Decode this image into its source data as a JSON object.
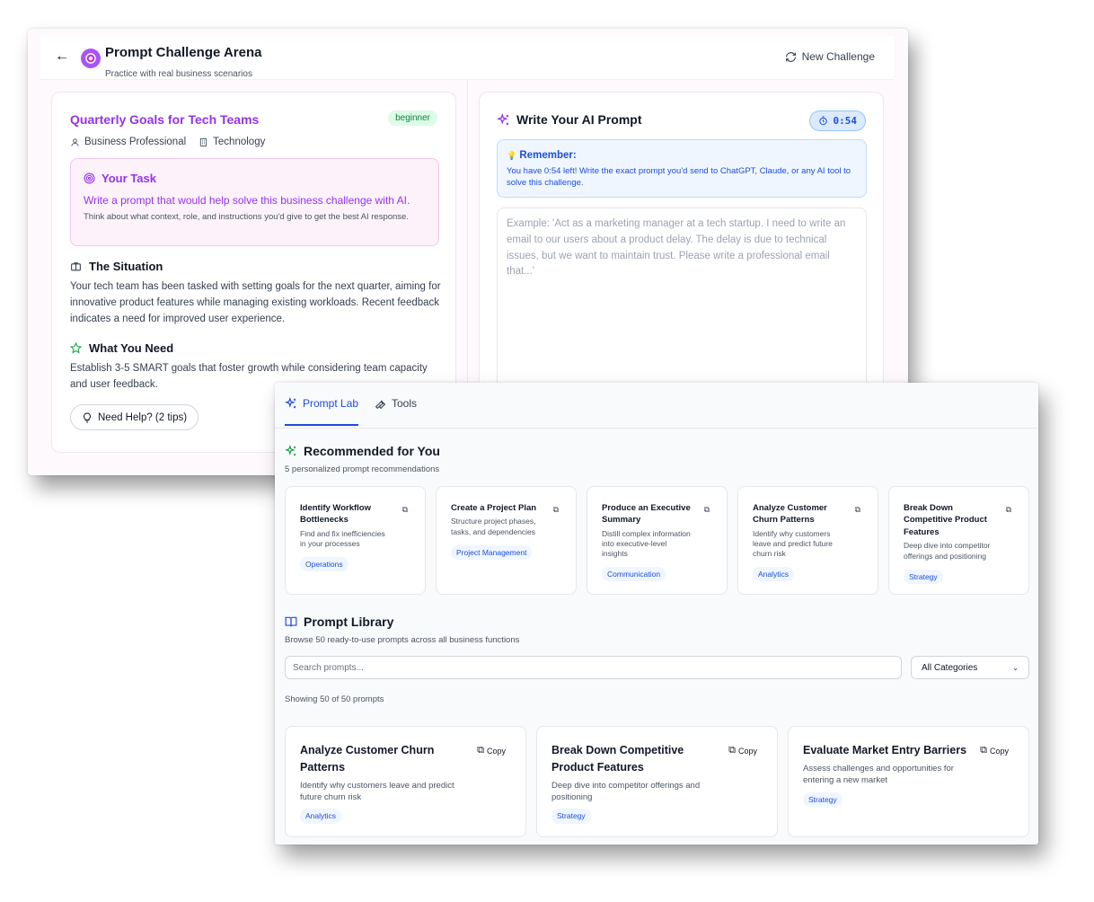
{
  "arena": {
    "title": "Prompt Challenge Arena",
    "subtitle": "Practice with real business scenarios",
    "new_challenge": "New Challenge",
    "challenge": {
      "title": "Quarterly Goals for Tech Teams",
      "level": "beginner",
      "role": "Business Professional",
      "industry": "Technology",
      "task_heading": "Your Task",
      "task_line": "Write a prompt that would help solve this business challenge with AI.",
      "task_hint": "Think about what context, role, and instructions you'd give to get the best AI response.",
      "situation_heading": "The Situation",
      "situation_text": "Your tech team has been tasked with setting goals for the next quarter, aiming for innovative product features while managing existing workloads. Recent feedback indicates a need for improved user experience.",
      "need_heading": "What You Need",
      "need_text": "Establish 3-5 SMART goals that foster growth while considering team capacity and user feedback.",
      "help_button": "Need Help? (2 tips)"
    },
    "writer": {
      "heading": "Write Your AI Prompt",
      "timer": "0:54",
      "remember_heading": "Remember:",
      "remember_text": "You have 0:54 left! Write the exact prompt you'd send to ChatGPT, Claude, or any AI tool to solve this challenge.",
      "placeholder": "Example: 'Act as a marketing manager at a tech startup. I need to write an email to our users about a product delay. The delay is due to technical issues, but we want to maintain trust. Please write a professional email that...'"
    }
  },
  "lab": {
    "tabs": [
      {
        "label": "Prompt Lab",
        "active": true
      },
      {
        "label": "Tools",
        "active": false
      }
    ],
    "recommended_heading": "Recommended for You",
    "recommended_sub": "5 personalized prompt recommendations",
    "recommendations": [
      {
        "title": "Identify Workflow Bottlenecks",
        "desc": "Find and fix inefficiencies in your processes",
        "tag": "Operations"
      },
      {
        "title": "Create a Project Plan",
        "desc": "Structure project phases, tasks, and dependencies",
        "tag": "Project Management"
      },
      {
        "title": "Produce an Executive Summary",
        "desc": "Distill complex information into executive-level insights",
        "tag": "Communication"
      },
      {
        "title": "Analyze Customer Churn Patterns",
        "desc": "Identify why customers leave and predict future churn risk",
        "tag": "Analytics"
      },
      {
        "title": "Break Down Competitive Product Features",
        "desc": "Deep dive into competitor offerings and positioning",
        "tag": "Strategy"
      }
    ],
    "library_heading": "Prompt Library",
    "library_sub": "Browse 50 ready-to-use prompts across all business functions",
    "search_placeholder": "Search prompts...",
    "category_selected": "All Categories",
    "showing": "Showing 50 of 50 prompts",
    "copy_label": "Copy",
    "library_items": [
      {
        "title": "Analyze Customer Churn Patterns",
        "desc": "Identify why customers leave and predict future churn risk",
        "tag": "Analytics"
      },
      {
        "title": "Break Down Competitive Product Features",
        "desc": "Deep dive into competitor offerings and positioning",
        "tag": "Strategy"
      },
      {
        "title": "Evaluate Market Entry Barriers",
        "desc": "Assess challenges and opportunities for entering a new market",
        "tag": "Strategy"
      }
    ]
  },
  "colors": {
    "purple": "#9333ea",
    "blue": "#1d4ed8",
    "green": "#16a34a"
  }
}
